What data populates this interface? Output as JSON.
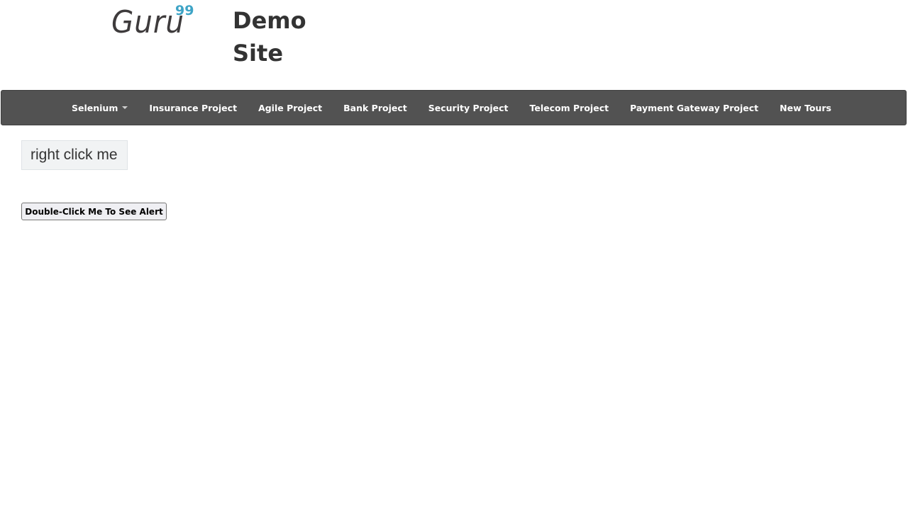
{
  "brand": {
    "logo_text": "Guru",
    "logo_superscript": "99",
    "site_title": "Demo Site",
    "colors": {
      "logo_text": "#3e3b3c",
      "logo_superscript": "#3ea4c6"
    }
  },
  "navbar": {
    "background": "#525252",
    "items": [
      {
        "label": "Selenium",
        "has_dropdown": true
      },
      {
        "label": "Insurance Project"
      },
      {
        "label": "Agile Project"
      },
      {
        "label": "Bank Project"
      },
      {
        "label": "Security Project"
      },
      {
        "label": "Telecom Project"
      },
      {
        "label": "Payment Gateway Project"
      },
      {
        "label": "New Tours"
      }
    ]
  },
  "main": {
    "right_click_label": "right click me",
    "double_click_button": "Double-Click Me To See Alert"
  }
}
